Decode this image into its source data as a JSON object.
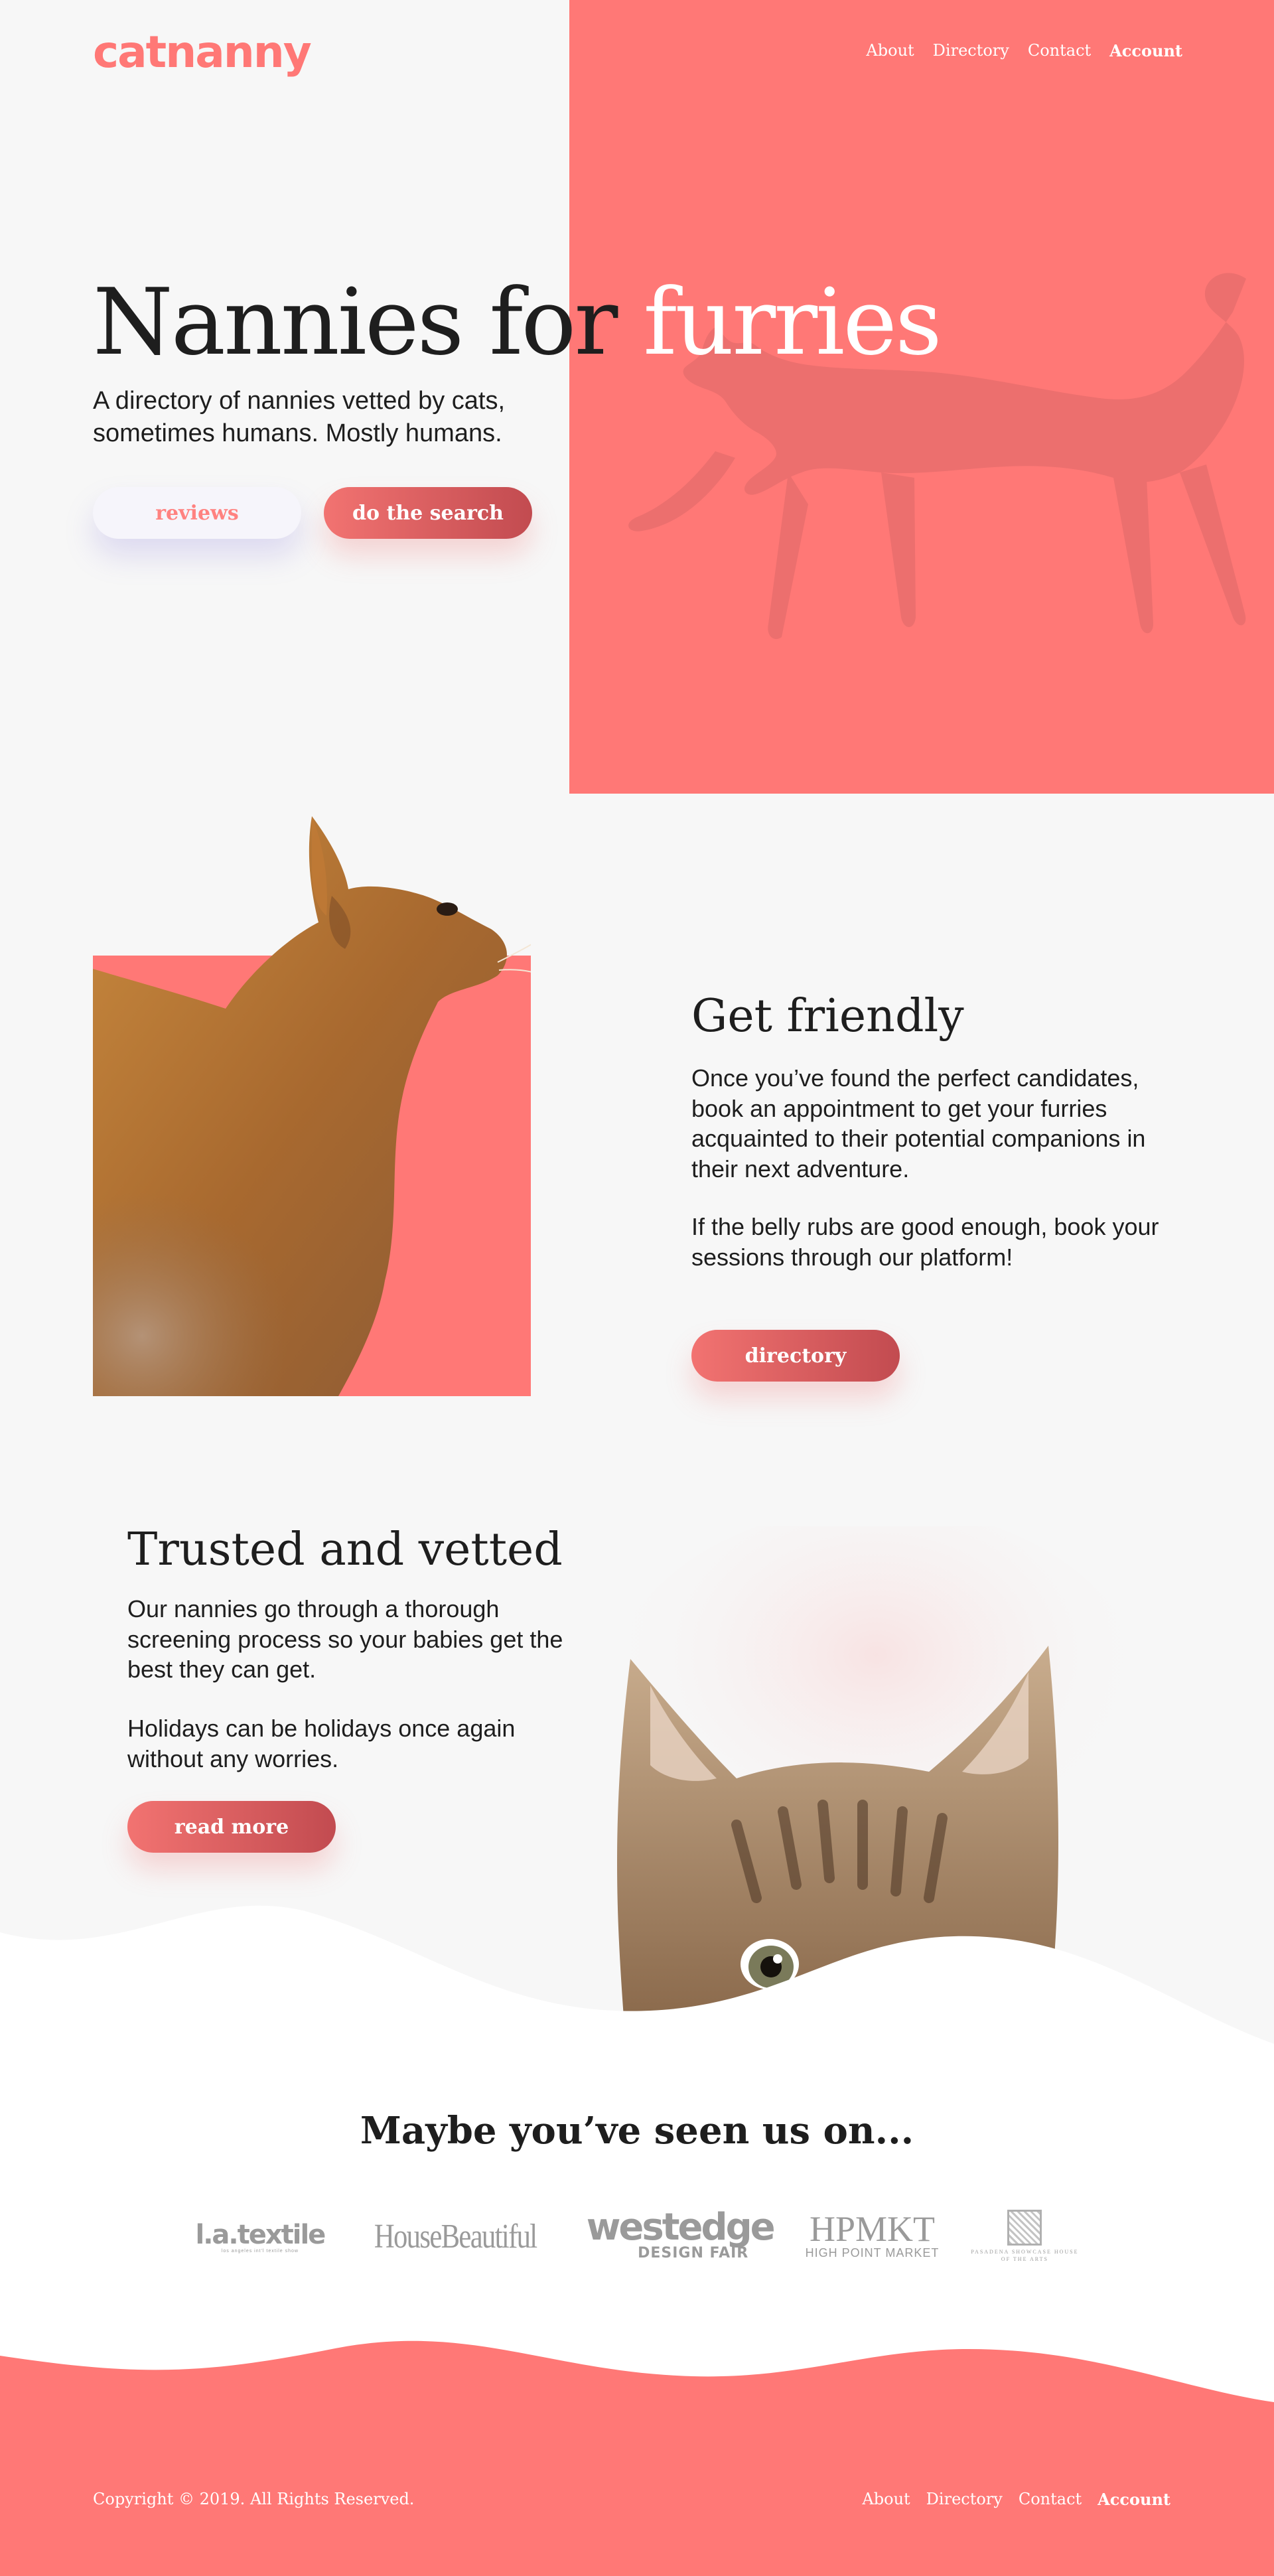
{
  "brand": {
    "logo": "catnanny"
  },
  "nav": {
    "about": "About",
    "directory": "Directory",
    "contact": "Contact",
    "account": "Account"
  },
  "hero": {
    "title_dark": "Nannies for",
    "title_light": "furries",
    "subtitle": "A directory of nannies vetted by cats, sometimes humans. Mostly humans.",
    "btn_reviews": "reviews",
    "btn_search": "do the search"
  },
  "friendly": {
    "title": "Get friendly",
    "p1": "Once you’ve found the perfect candidates, book an appointment to get your furries acquainted to their potential companions in their next adventure.",
    "p2": "If the belly rubs are good enough,  book your sessions through our platform!",
    "btn": "directory"
  },
  "trusted": {
    "title": "Trusted and vetted",
    "p1": "Our nannies go through a thorough screening process so your babies get the best they can get.",
    "p2": "Holidays can be holidays once again without any worries.",
    "btn": "read more"
  },
  "seen": {
    "title": "Maybe you’ve seen us on...",
    "logos": {
      "latextile": "l.a.textile",
      "latextile_sub": "los angeles int'l textile show",
      "housebeautiful": "HouseBeautiful",
      "westedge": "westedge",
      "westedge_sub": "DESIGN FAIR",
      "hpmkt": "HPMKT",
      "hpmkt_sub": "HIGH POINT MARKET",
      "house": "PASADENA SHOWCASE HOUSE",
      "house_sub": "OF THE ARTS"
    }
  },
  "footer": {
    "copyright": "Copyright © 2019. All Rights Reserved.",
    "about": "About",
    "directory": "Directory",
    "contact": "Contact",
    "account": "Account"
  },
  "colors": {
    "accent": "#ff7876",
    "button_gradient_end": "#c24b50",
    "background": "#f7f7f7"
  }
}
